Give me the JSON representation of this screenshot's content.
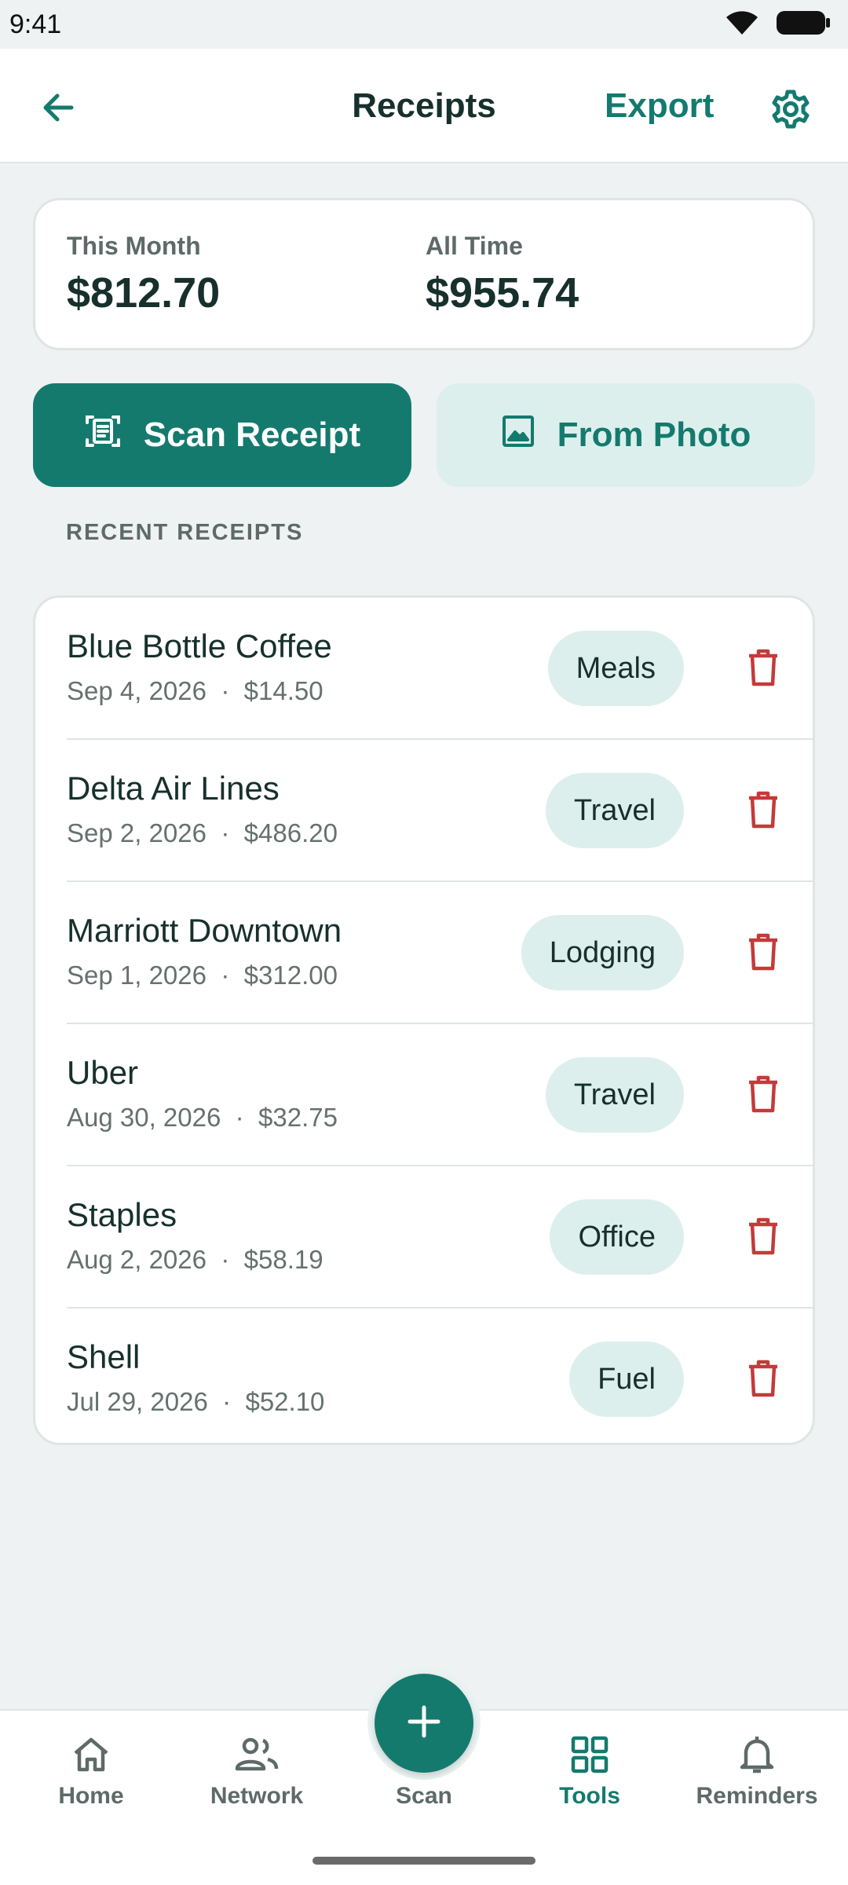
{
  "status_bar": {
    "time": "9:41"
  },
  "app_bar": {
    "title": "Receipts",
    "export_label": "Export"
  },
  "summary": {
    "this_month_label": "This Month",
    "this_month_value": "$812.70",
    "all_time_label": "All Time",
    "all_time_value": "$955.74"
  },
  "actions": {
    "scan_label": "Scan Receipt",
    "photo_label": "From Photo"
  },
  "section_label": "RECENT RECEIPTS",
  "receipts": [
    {
      "name": "Blue Bottle Coffee",
      "meta": "Sep 4, 2026  ·  $14.50",
      "category": "Meals"
    },
    {
      "name": "Delta Air Lines",
      "meta": "Sep 2, 2026  ·  $486.20",
      "category": "Travel"
    },
    {
      "name": "Marriott Downtown",
      "meta": "Sep 1, 2026  ·  $312.00",
      "category": "Lodging"
    },
    {
      "name": "Uber",
      "meta": "Aug 30, 2026  ·  $32.75",
      "category": "Travel"
    },
    {
      "name": "Staples",
      "meta": "Aug 2, 2026  ·  $58.19",
      "category": "Office"
    },
    {
      "name": "Shell",
      "meta": "Jul 29, 2026  ·  $52.10",
      "category": "Fuel"
    }
  ],
  "nav": {
    "home": "Home",
    "network": "Network",
    "scan": "Scan",
    "tools": "Tools",
    "reminders": "Reminders",
    "active": "tools"
  },
  "colors": {
    "accent": "#147a6e",
    "chip_bg": "#ddefec",
    "delete": "#c43a3a",
    "background": "#eef2f2"
  }
}
